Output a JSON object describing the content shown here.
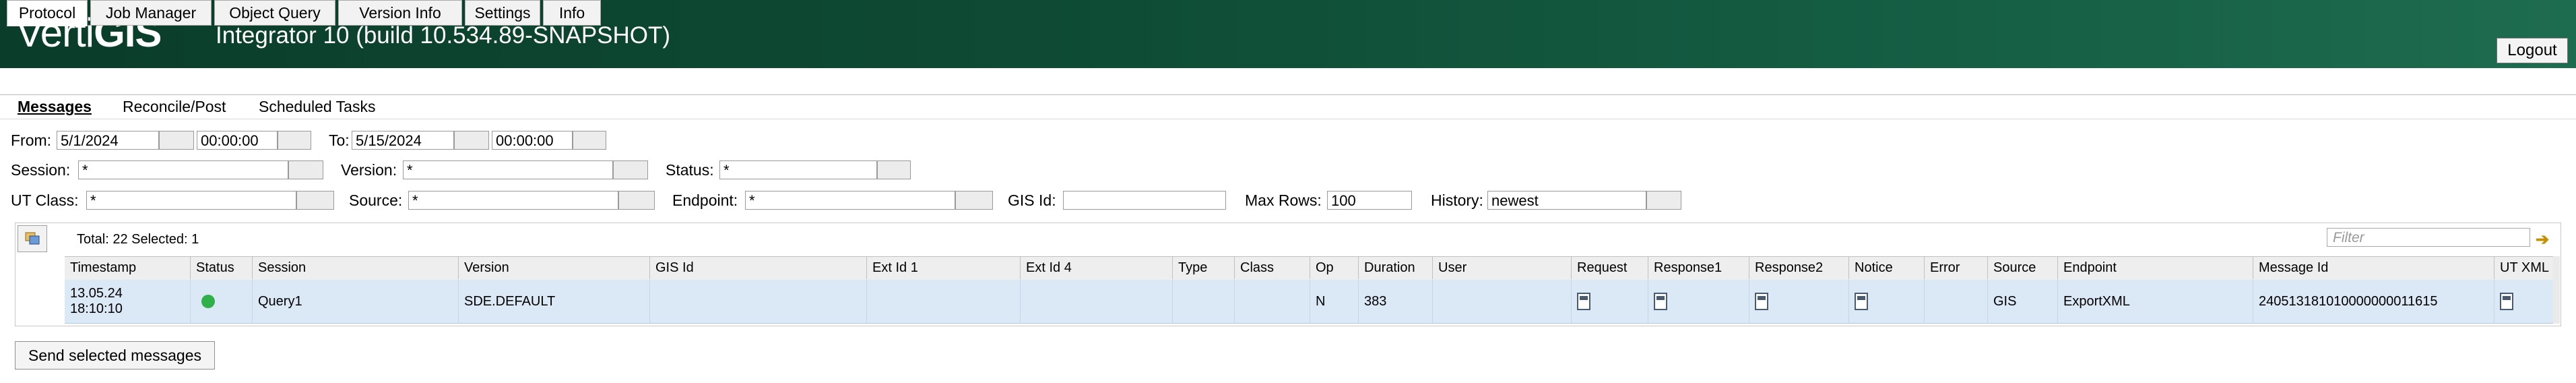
{
  "header": {
    "logo_main": "Verti",
    "logo_accent": "GIS",
    "logo_tm": "™",
    "title": "Integrator 10 (build 10.534.89-SNAPSHOT)",
    "logout_label": "Logout"
  },
  "tabs": [
    "Protocol",
    "Job Manager",
    "Object Query",
    "Version Info",
    "Settings",
    "Info"
  ],
  "subtabs": [
    "Messages",
    "Reconcile/Post",
    "Scheduled Tasks"
  ],
  "filters": {
    "from_label": "From:",
    "from_date": "5/1/2024",
    "from_time": "00:00:00",
    "to_label": "To:",
    "to_date": "5/15/2024",
    "to_time": "00:00:00",
    "session_label": "Session:",
    "session_value": "*",
    "version_label": "Version:",
    "version_value": "*",
    "status_label": "Status:",
    "status_value": "*",
    "utclass_label": "UT Class:",
    "utclass_value": "*",
    "source_label": "Source:",
    "source_value": "*",
    "endpoint_label": "Endpoint:",
    "endpoint_value": "*",
    "gisid_label": "GIS Id:",
    "gisid_value": "",
    "maxrows_label": "Max Rows:",
    "maxrows_value": "100",
    "history_label": "History:",
    "history_value": "newest"
  },
  "grid": {
    "total_text": "Total: 22 Selected: 1",
    "filter_placeholder": "Filter",
    "columns": [
      "Timestamp",
      "Status",
      "Session",
      "Version",
      "GIS Id",
      "Ext Id 1",
      "Ext Id 4",
      "Type",
      "Class",
      "Op",
      "Duration",
      "User",
      "Request",
      "Response1",
      "Response2",
      "Notice",
      "Error",
      "Source",
      "Endpoint",
      "Message Id",
      "UT XML"
    ],
    "row": {
      "timestamp_date": "13.05.24",
      "timestamp_time": "18:10:10",
      "status": "green-dot",
      "session": "Query1",
      "version": "SDE.DEFAULT",
      "gis_id": "",
      "ext_id_1": "",
      "ext_id_4": "",
      "type": "",
      "class": "",
      "op": "N",
      "duration": "383",
      "user": "",
      "source": "GIS",
      "endpoint": "ExportXML",
      "message_id": "240513181010000000011615"
    }
  },
  "send_button_label": "Send selected messages",
  "colors": {
    "header_bg": "#0e4a34",
    "selected_row": "#dbe8f6",
    "status_ok": "#2fb04a"
  }
}
